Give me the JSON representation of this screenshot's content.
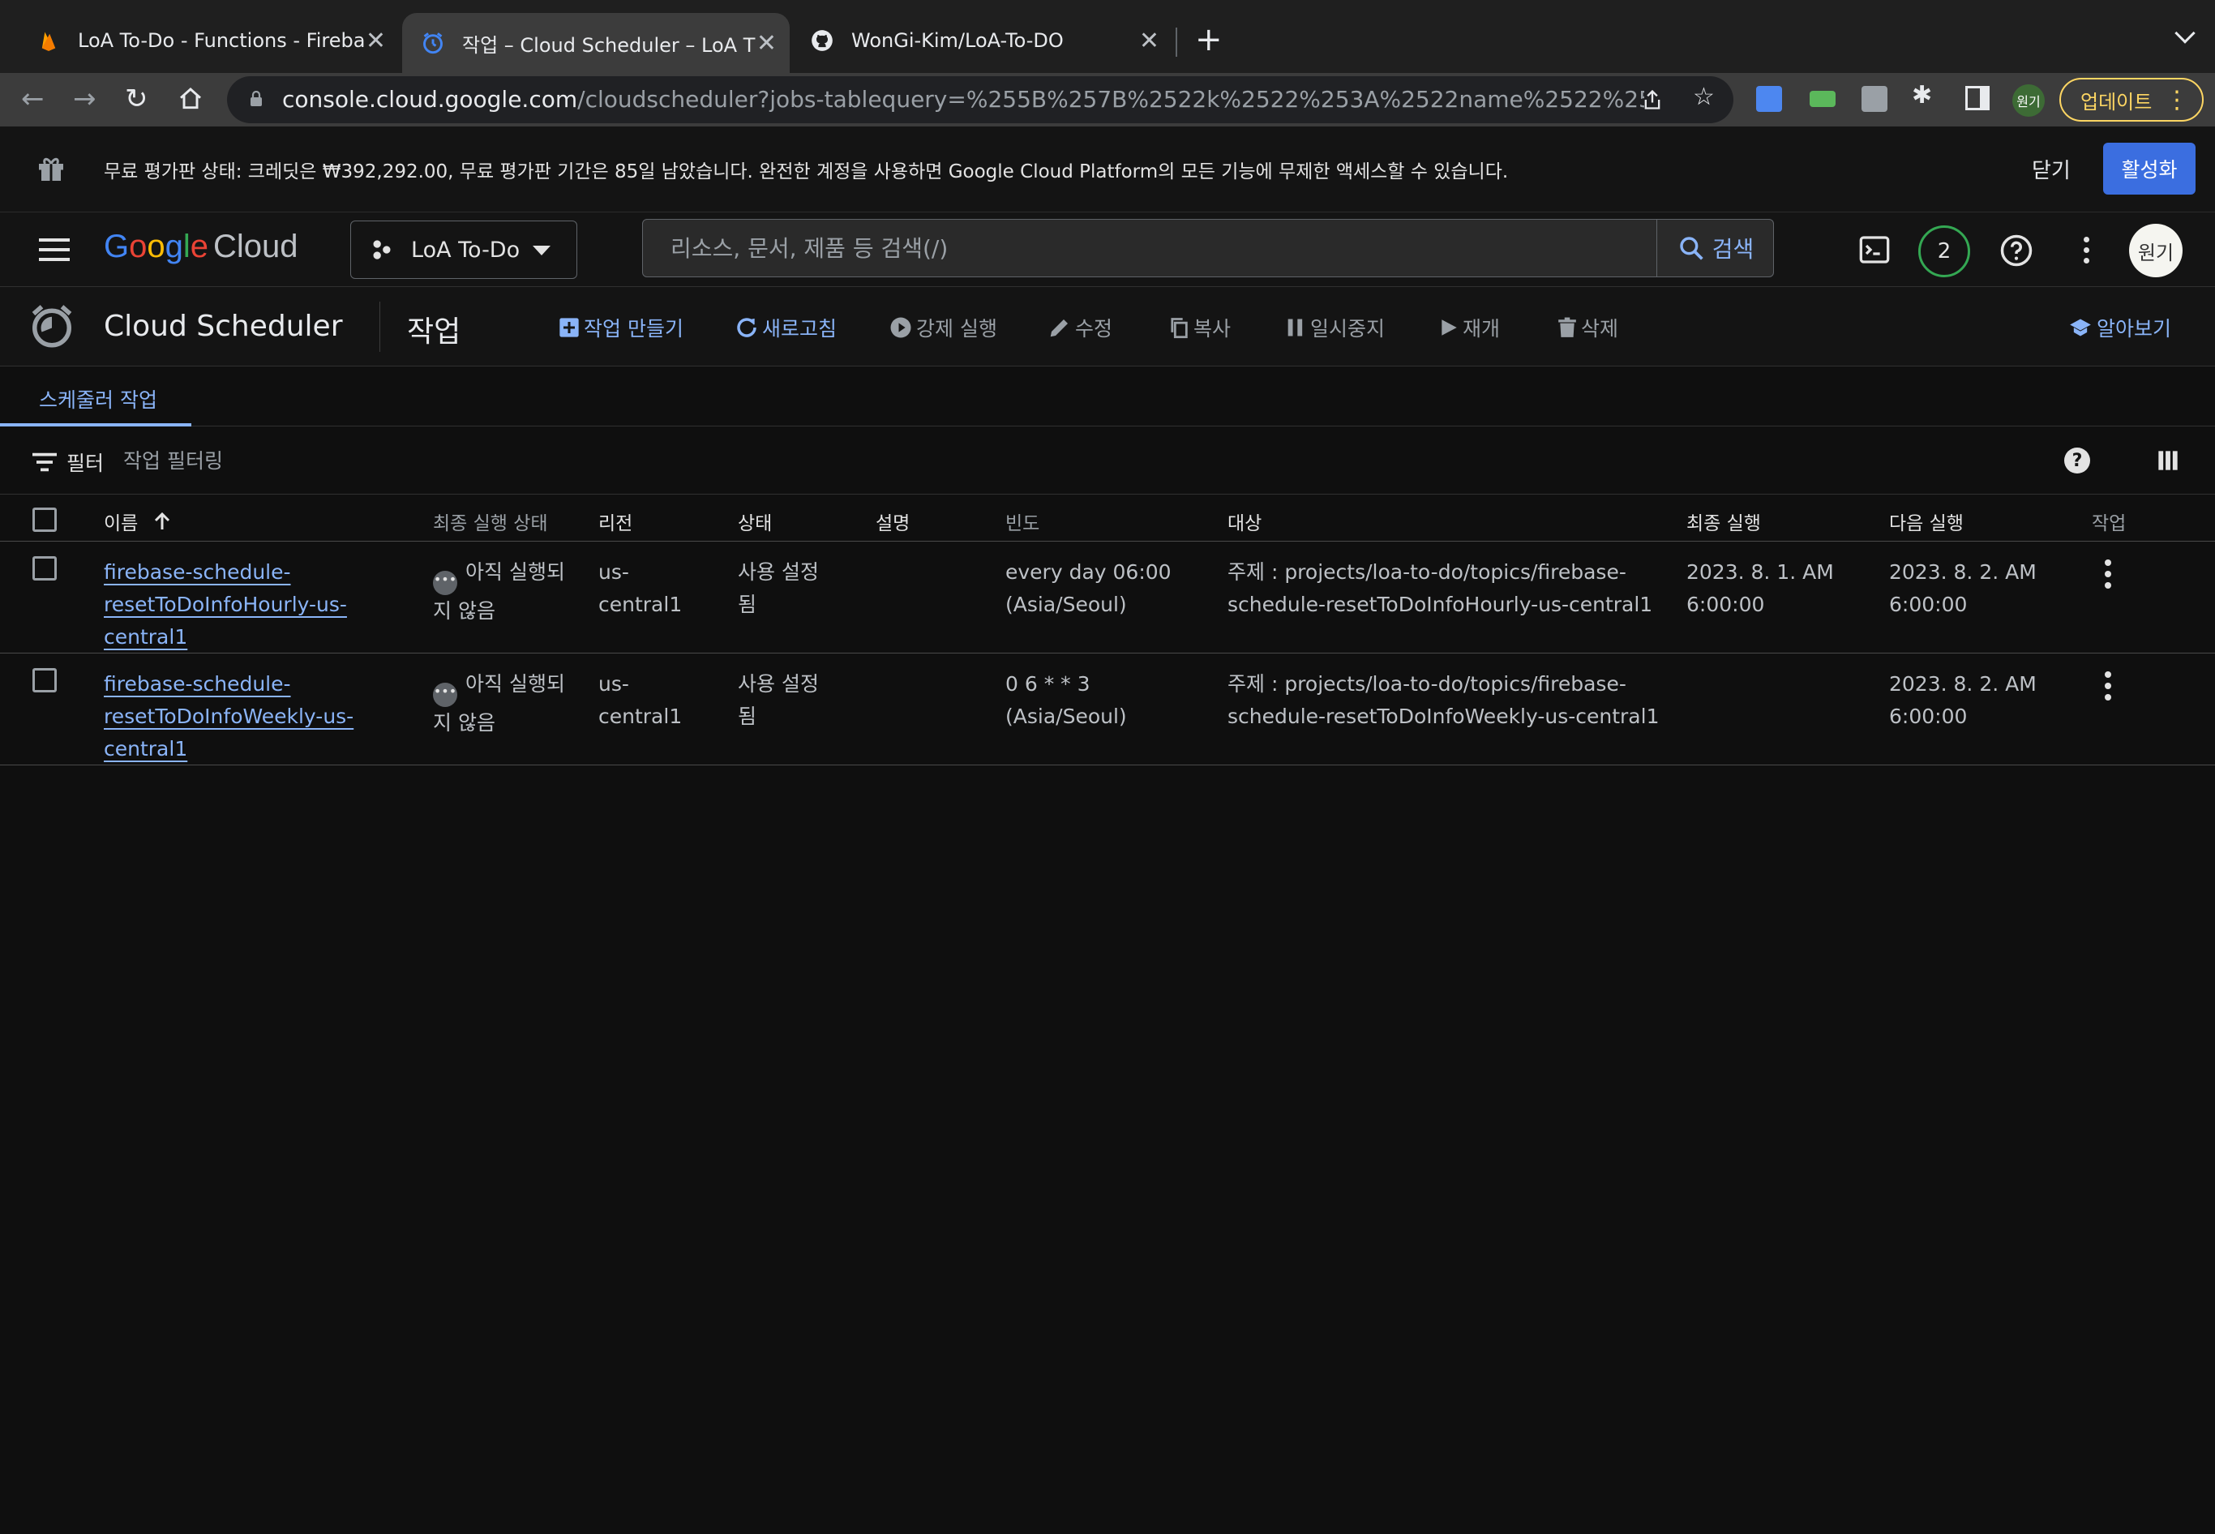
{
  "browser": {
    "tabs": [
      {
        "title": "LoA To-Do - Functions - Fireba",
        "active": false
      },
      {
        "title": "작업 – Cloud Scheduler – LoA T",
        "active": true
      },
      {
        "title": "WonGi-Kim/LoA-To-DO",
        "active": false
      }
    ],
    "url_host": "console.cloud.google.com",
    "url_path": "/cloudscheduler?jobs-tablequery=%255B%257B%2522k%2522%253A%2522name%2522%252...",
    "profile_chip": "원기",
    "update_label": "업데이트"
  },
  "banner": {
    "message": "무료 평가판 상태: 크레딧은 ₩392,292.00, 무료 평가판 기간은 85일 남았습니다. 완전한 계정을 사용하면 Google Cloud Platform의 모든 기능에 무제한 액세스할 수 있습니다.",
    "close_label": "닫기",
    "activate_label": "활성화"
  },
  "header": {
    "logo_cloud": "Cloud",
    "project_name": "LoA To-Do",
    "search_placeholder": "리소스, 문서, 제품 등 검색(/)",
    "search_button": "검색",
    "notification_count": "2",
    "avatar_text": "원기"
  },
  "service": {
    "title": "Cloud Scheduler",
    "page": "작업",
    "actions": {
      "create": "작업 만들기",
      "refresh": "새로고침",
      "force_run": "강제 실행",
      "edit": "수정",
      "copy": "복사",
      "pause": "일시중지",
      "resume": "재개",
      "delete": "삭제",
      "learn": "알아보기"
    }
  },
  "subtab": "스케줄러 작업",
  "filter": {
    "label": "필터",
    "placeholder": "작업 필터링"
  },
  "table": {
    "headers": {
      "name": "이름",
      "last_status": "최종 실행 상태",
      "region": "리전",
      "state": "상태",
      "description": "설명",
      "frequency": "빈도",
      "target": "대상",
      "last_run": "최종 실행",
      "next_run": "다음 실행",
      "actions": "작업"
    },
    "rows": [
      {
        "name_l1": "firebase-schedule-",
        "name_l2": "resetToDoInfoHourly-us-",
        "name_l3": "central1",
        "status_l1": "아직 실행되",
        "status_l2": "지 않음",
        "region_l1": "us-",
        "region_l2": "central1",
        "state_l1": "사용 설정",
        "state_l2": "됨",
        "description": "",
        "freq_l1": "every day 06:00",
        "freq_l2": "(Asia/Seoul)",
        "target_l1": "주제 : projects/loa-to-do/topics/firebase-",
        "target_l2": "schedule-resetToDoInfoHourly-us-central1",
        "last_l1": "2023. 8. 1. AM",
        "last_l2": "6:00:00",
        "next_l1": "2023. 8. 2. AM",
        "next_l2": "6:00:00"
      },
      {
        "name_l1": "firebase-schedule-",
        "name_l2": "resetToDoInfoWeekly-us-",
        "name_l3": "central1",
        "status_l1": "아직 실행되",
        "status_l2": "지 않음",
        "region_l1": "us-",
        "region_l2": "central1",
        "state_l1": "사용 설정",
        "state_l2": "됨",
        "description": "",
        "freq_l1": "0 6 * * 3",
        "freq_l2": "(Asia/Seoul)",
        "target_l1": "주제 : projects/loa-to-do/topics/firebase-",
        "target_l2": "schedule-resetToDoInfoWeekly-us-central1",
        "last_l1": "",
        "last_l2": "",
        "next_l1": "2023. 8. 2. AM",
        "next_l2": "6:00:00"
      }
    ]
  },
  "colors": {
    "accent": "#8ab4f8",
    "primary_button": "#3b6ee0",
    "update_yellow": "#fdd663"
  }
}
